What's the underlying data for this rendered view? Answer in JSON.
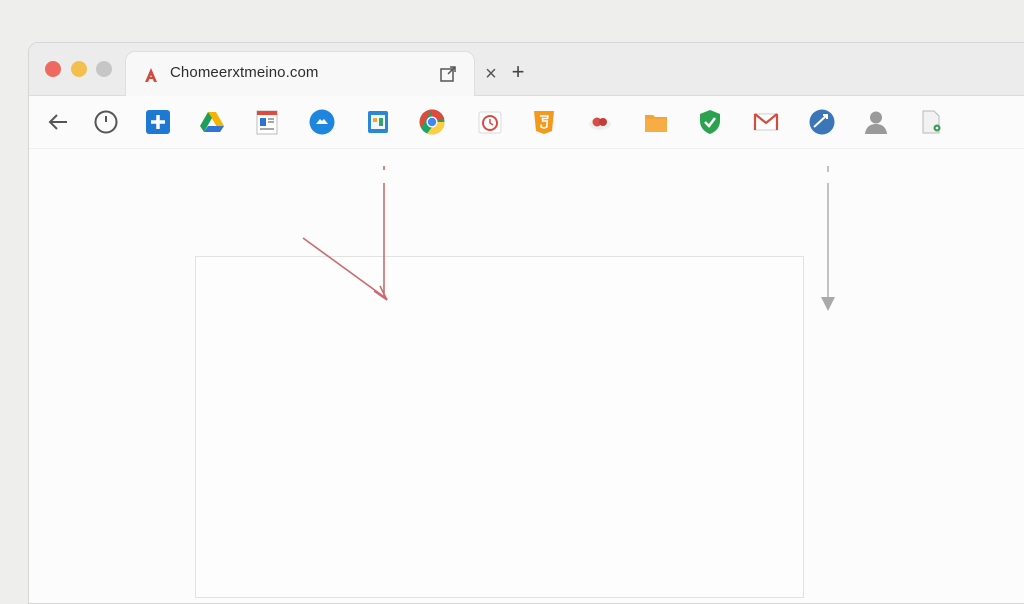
{
  "window": {
    "traffic_lights": [
      "close",
      "minimize",
      "zoom"
    ],
    "colors": {
      "close": "#ee6a60",
      "minimize": "#f3bf4f",
      "zoom": "#c6c6c6",
      "accent": "#d44a3f"
    }
  },
  "tab": {
    "title": "Chomeerxtmeino.com",
    "favicon": "red-a-logo-icon",
    "action_icon": "external-window-icon",
    "close_label": "×"
  },
  "newtab": {
    "label": "+"
  },
  "toolbar": {
    "items": [
      "back-arrow-icon",
      "history-clock-icon",
      "blue-plus-icon",
      "drive-icon",
      "docs-icon",
      "blue-circle-app-icon",
      "calendar-app-icon",
      "chrome-icon",
      "timer-app-icon",
      "html5-icon",
      "cloud-app-icon",
      "folder-icon",
      "shield-check-icon",
      "gmail-icon",
      "globe-app-icon",
      "person-icon",
      "document-gear-icon"
    ]
  }
}
